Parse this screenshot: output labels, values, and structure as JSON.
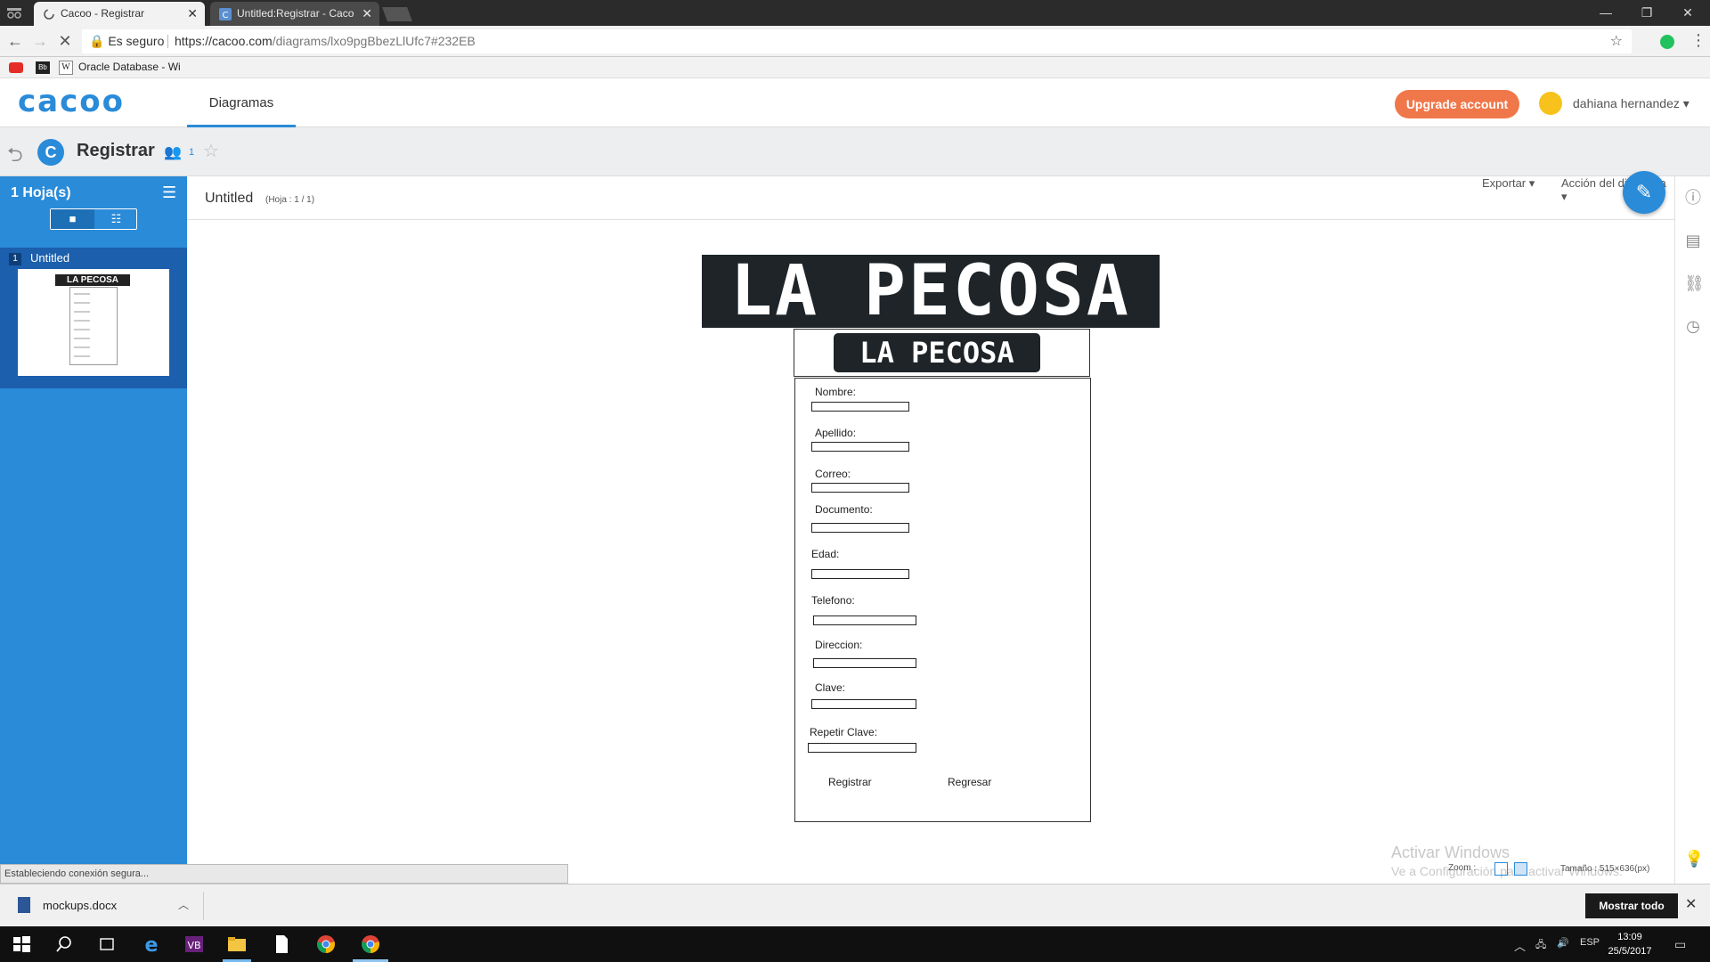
{
  "browser": {
    "tabs": [
      {
        "title": "Cacoo - Registrar",
        "active": true
      },
      {
        "title": "Untitled:Registrar - Caco",
        "active": false
      }
    ],
    "secure_label": "Es seguro",
    "url_host": "https://cacoo.com",
    "url_path": "/diagrams/lxo9pgBbezLlUfc7#232EB",
    "bookmark_label": "Oracle Database - Wi",
    "bookmark_bb": "Bb",
    "bookmark_w": "W"
  },
  "app": {
    "logo": "cacoo",
    "nav_tab": "Diagramas",
    "upgrade_label": "Upgrade account",
    "username": "dahiana hernandez",
    "diagram_title": "Registrar",
    "collaborators": "1",
    "badge_letter": "C"
  },
  "sidebar": {
    "sheets_title": "1 Hoja(s)",
    "sheet_number": "1",
    "sheet_name": "Untitled"
  },
  "canvas": {
    "sheet_title": "Untitled",
    "sheet_info": "(Hoja : 1 / 1)",
    "menu_export": "Exportar",
    "menu_action": "Acción del diagrama",
    "banner_text": "LA PECOSA",
    "logo_text": "LA PECOSA",
    "thumb_text": "LA PECOSA",
    "fields": [
      {
        "label": "Nombre:"
      },
      {
        "label": "Apellido:"
      },
      {
        "label": "Correo:"
      },
      {
        "label": "Documento:"
      },
      {
        "label": "Edad:"
      },
      {
        "label": "Telefono:"
      },
      {
        "label": "Direccion:"
      },
      {
        "label": "Clave:"
      },
      {
        "label": "Repetir Clave:"
      }
    ],
    "register_button": "Registrar",
    "back_button": "Regresar",
    "zoom_label": "Zoom :",
    "size_label": "Tamaño : 515×636(px)",
    "watermark_title": "Activar Windows",
    "watermark_sub": "Ve a Configuración para activar Windows."
  },
  "status": {
    "connection": "Estableciendo conexión segura..."
  },
  "downloads": {
    "file_name": "mockups.docx",
    "show_all": "Mostrar todo"
  },
  "taskbar": {
    "lang": "ESP",
    "time": "13:09",
    "date": "25/5/2017"
  },
  "colors": {
    "accent": "#2a8bd8",
    "upgrade": "#f0774a",
    "sidebar": "#2a8bd8"
  }
}
